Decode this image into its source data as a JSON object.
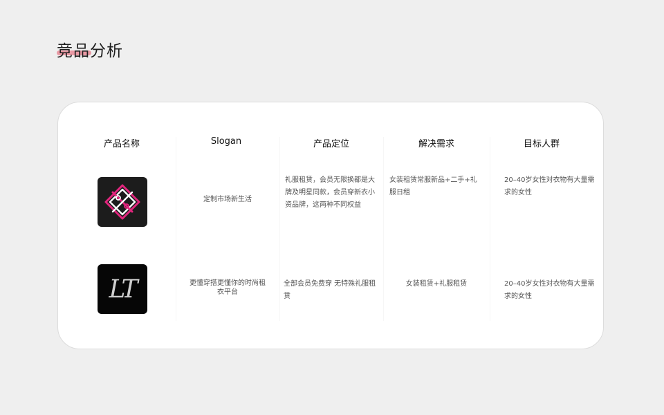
{
  "page": {
    "title": "竞品分析"
  },
  "table": {
    "headers": [
      "产品名称",
      "Slogan",
      "产品定位",
      "解决需求",
      "目标人群"
    ],
    "rows": [
      {
        "logo_icon": "hangers-diamond-logo-icon",
        "slogan": "定制市场新生活",
        "positioning": "礼服租赁，会员无限换都是大牌及明星同款，会员穿新衣小资品牌，这两种不同权益",
        "needs": "女装租赁常服新品+二手+礼服日租",
        "audience": "20–40岁女性对衣物有大量需求的女性"
      },
      {
        "logo_icon": "lt-logo-icon",
        "logo_text": "LT",
        "slogan": "更懂穿搭更懂你的时尚租衣平台",
        "positioning": "全部会员免费穿  无特殊礼服租赁",
        "needs": "女装租赁+礼服租赁",
        "audience": "20–40岁女性对衣物有大量需求的女性"
      }
    ]
  },
  "colors": {
    "accent": "#e88a96",
    "logo_pink": "#e2257d",
    "card_bg": "#ffffff",
    "page_bg": "#efefef"
  }
}
